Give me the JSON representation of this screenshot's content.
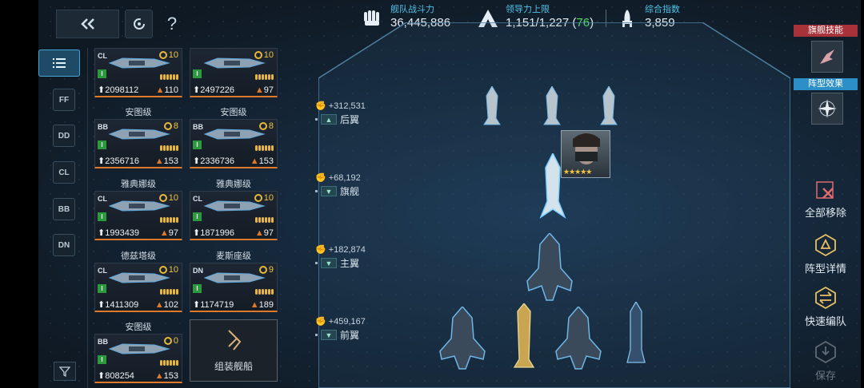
{
  "top_bar": {
    "help": "?",
    "fleet_power": {
      "label": "舰队战斗力",
      "value": "36,445,886"
    },
    "leadership": {
      "label": "领导力上限",
      "value": "1,151/1,227",
      "extra": "76",
      "open": "(",
      "close": ")"
    },
    "index": {
      "label": "综合指数",
      "value": "3,859"
    }
  },
  "tabs": [
    "FF",
    "DD",
    "CL",
    "BB",
    "DN"
  ],
  "cards": [
    {
      "name": "",
      "cls": "CL",
      "lvl": "10",
      "power": "2098112",
      "lead": "110"
    },
    {
      "name": "",
      "cls": "",
      "lvl": "10",
      "power": "2497226",
      "lead": "97"
    },
    {
      "name": "安图级",
      "cls": "BB",
      "lvl": "8",
      "power": "2356716",
      "lead": "153"
    },
    {
      "name": "安图级",
      "cls": "BB",
      "lvl": "8",
      "power": "2336736",
      "lead": "153"
    },
    {
      "name": "雅典娜级",
      "cls": "CL",
      "lvl": "10",
      "power": "1993439",
      "lead": "97"
    },
    {
      "name": "雅典娜级",
      "cls": "CL",
      "lvl": "10",
      "power": "1871996",
      "lead": "97"
    },
    {
      "name": "德兹塔级",
      "cls": "CL",
      "lvl": "10",
      "power": "1411309",
      "lead": "102"
    },
    {
      "name": "麦斯座级",
      "cls": "DN",
      "lvl": "9",
      "power": "1174719",
      "lead": "189"
    },
    {
      "name": "安图级",
      "cls": "BB",
      "lvl": "0",
      "power": "808254",
      "lead": "153"
    }
  ],
  "tier": "I",
  "assemble_label": "组装舰船",
  "rows": [
    {
      "power": "+312,531",
      "name": "后翼"
    },
    {
      "power": "+68,192",
      "name": "旗舰"
    },
    {
      "power": "+182,874",
      "name": "主翼"
    },
    {
      "power": "+459,167",
      "name": "前翼"
    }
  ],
  "captain_stars": "★★★★★",
  "right": {
    "flagship_skill": "旗舰技能",
    "formation_effect": "阵型效果",
    "remove_all": "全部移除",
    "formation_detail": "阵型详情",
    "quick_form": "快速编队",
    "save": "保存"
  },
  "colors": {
    "accent": "#4fc3e8",
    "lead_icon": "#e07a2a",
    "star": "#f2c640",
    "green": "#4ee06a"
  }
}
